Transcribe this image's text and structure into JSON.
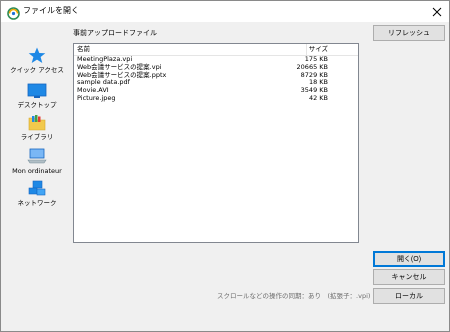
{
  "window": {
    "title": "ファイルを開く"
  },
  "nav": {
    "items": [
      {
        "label": "クイック アクセス",
        "icon": "star-icon"
      },
      {
        "label": "デスクトップ",
        "icon": "desktop-icon"
      },
      {
        "label": "ライブラリ",
        "icon": "library-folder-icon"
      },
      {
        "label": "Mon ordinateur",
        "icon": "computer-icon"
      },
      {
        "label": "ネットワーク",
        "icon": "network-icon"
      }
    ]
  },
  "main": {
    "section_label": "事前アップロードファイル",
    "refresh_label": "リフレッシュ",
    "columns": {
      "name": "名前",
      "size": "サイズ"
    },
    "files": [
      {
        "name": "MeetingPlaza.vpi",
        "size": "175 KB"
      },
      {
        "name": "Web会議サービスの提案.vpi",
        "size": "20665 KB"
      },
      {
        "name": "Web会議サービスの提案.pptx",
        "size": "8729 KB"
      },
      {
        "name": "sample data.pdf",
        "size": "18 KB"
      },
      {
        "name": "Movie.AVI",
        "size": "3549 KB"
      },
      {
        "name": "Picture.jpeg",
        "size": "42 KB"
      }
    ]
  },
  "footer": {
    "open_label": "開く(O)",
    "cancel_label": "キャンセル",
    "local_label": "ローカル",
    "status_text": "スクロールなどの操作の同期：あり　(拡張子：.vpi)"
  },
  "colors": {
    "accent": "#0078d7",
    "star": "#1e88e5",
    "folder": "#f2c94c"
  }
}
